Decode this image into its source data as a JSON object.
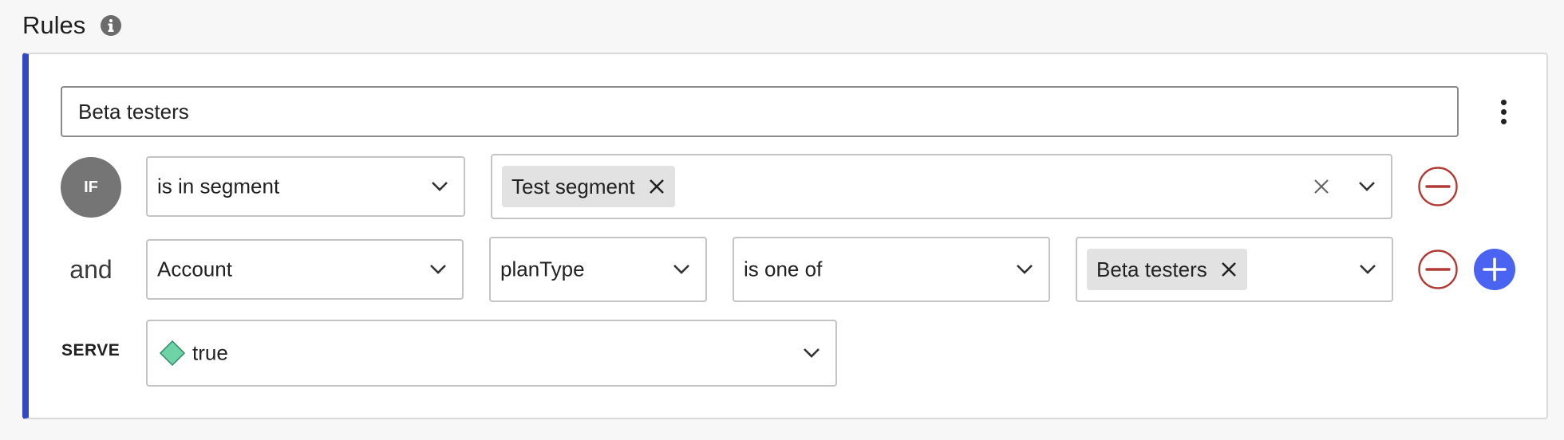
{
  "header": {
    "title": "Rules",
    "icon": "info-icon"
  },
  "rule": {
    "name_value": "Beta testers",
    "menu_icon": "more-vertical-icon"
  },
  "condition_if": {
    "badge": "IF",
    "operator": "is in segment",
    "segments": [
      "Test segment"
    ]
  },
  "condition_and": {
    "connector": "and",
    "context_kind": "Account",
    "attribute": "planType",
    "operator": "is one of",
    "values": [
      "Beta testers"
    ]
  },
  "serve": {
    "label": "SERVE",
    "variation": "true",
    "variation_color": "#6fd3a8"
  },
  "colors": {
    "accent_bar": "#3048c0",
    "remove": "#b13a35",
    "add": "#4a63f0",
    "badge": "#757575"
  }
}
